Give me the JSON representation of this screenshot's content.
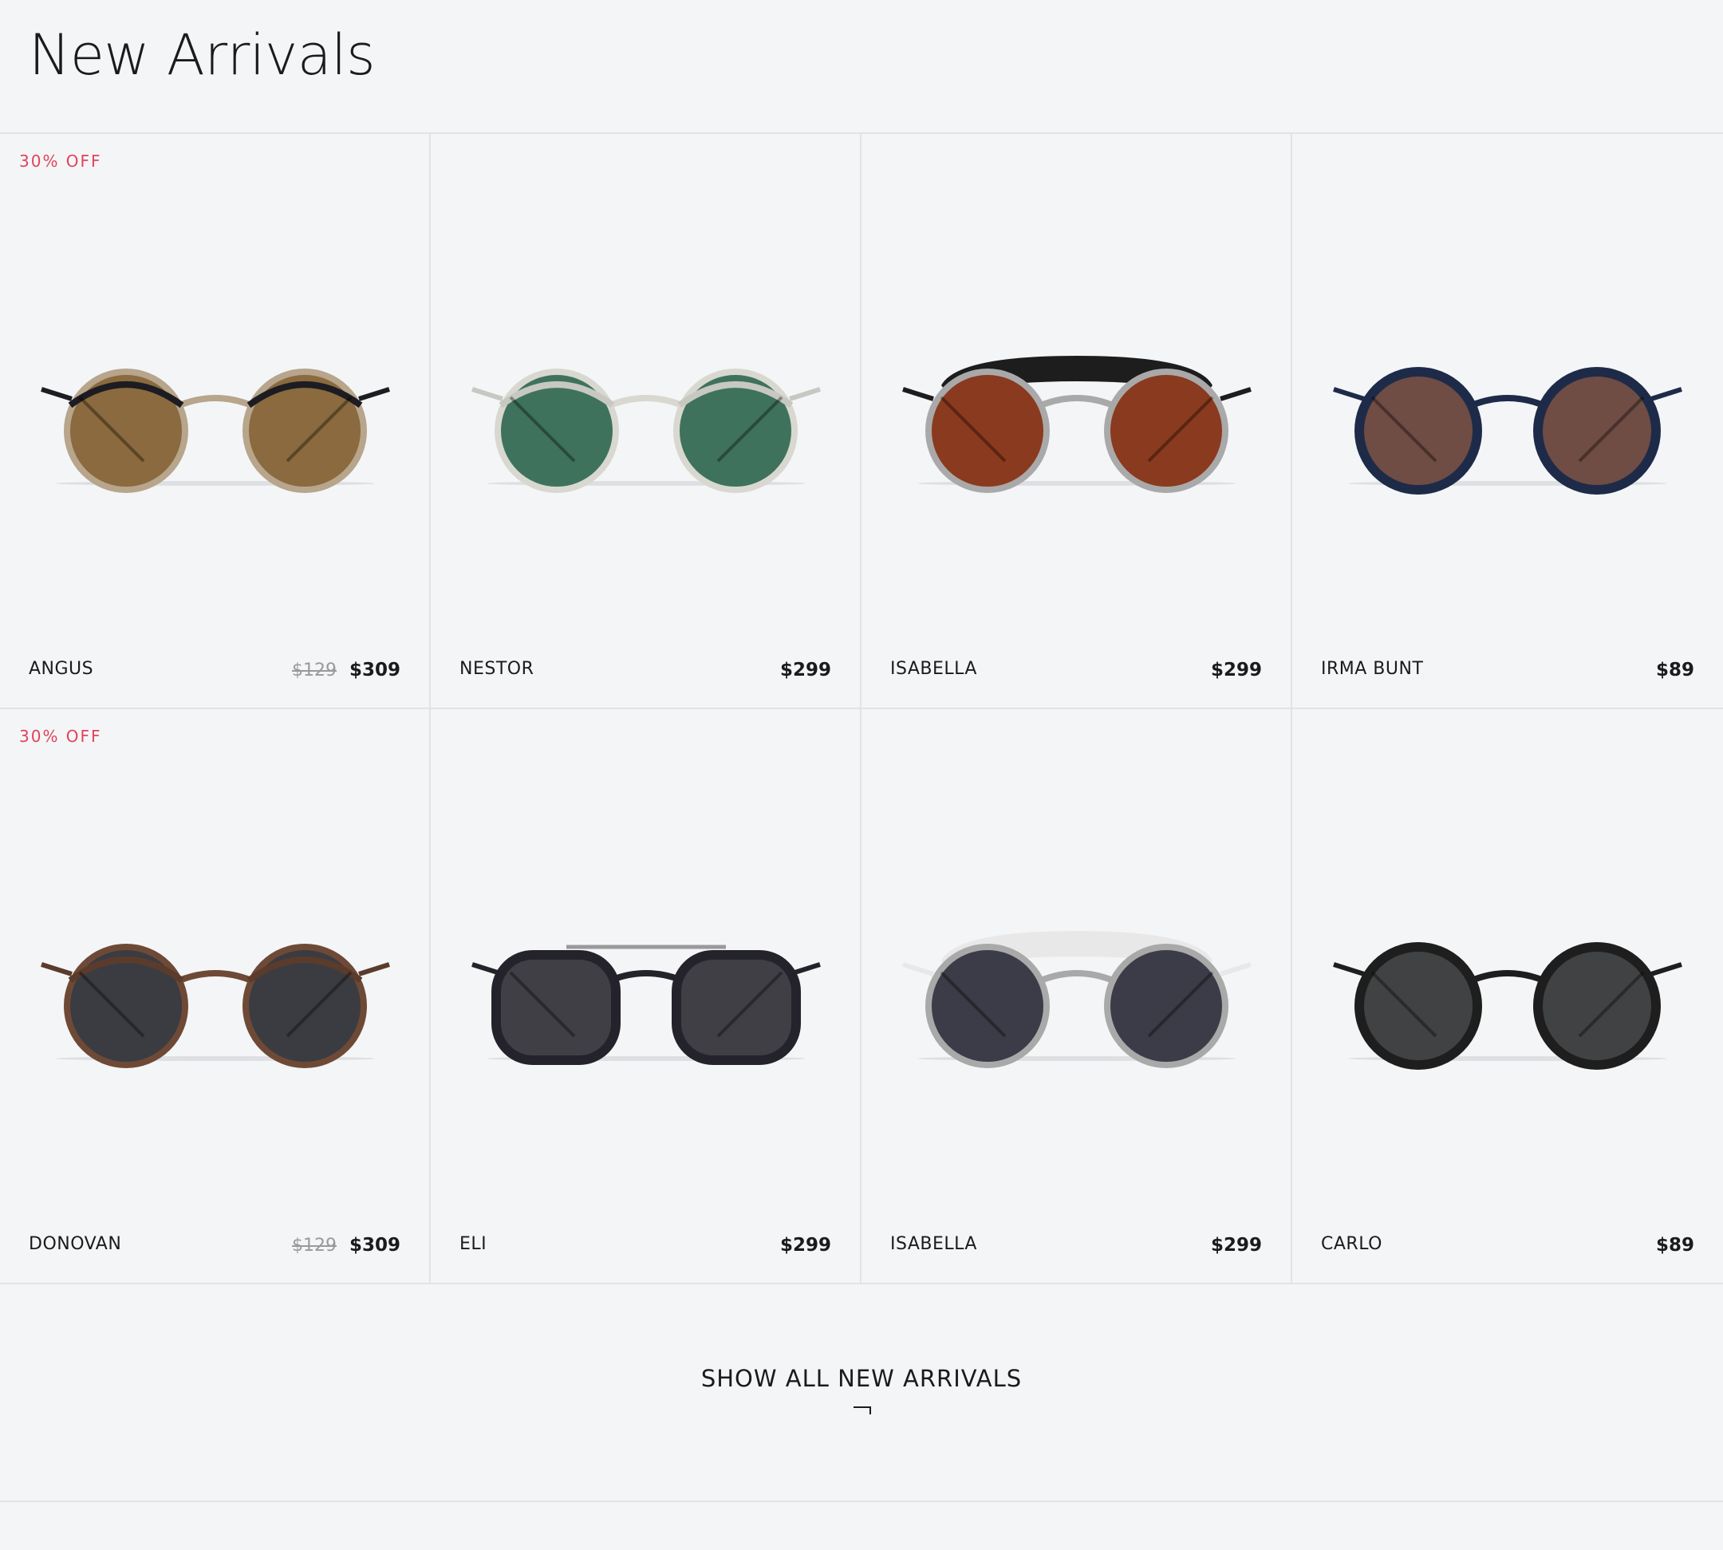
{
  "header": {
    "title": "New Arrivals"
  },
  "products": [
    {
      "name": "ANGUS",
      "badge": "30% OFF",
      "old_price": "$129",
      "price": "$309",
      "image": "round-brown-gradient-sunglasses",
      "frame": "#1c1c22",
      "lens": "#8a6a3e",
      "rim": "#b7a58c"
    },
    {
      "name": "NESTOR",
      "badge": "",
      "old_price": "",
      "price": "$299",
      "image": "round-silver-green-sunglasses",
      "frame": "#c8c8c2",
      "lens": "#3f725c",
      "rim": "#d8d8d0"
    },
    {
      "name": "ISABELLA",
      "badge": "",
      "old_price": "",
      "price": "$299",
      "image": "browbar-black-copper-sunglasses",
      "frame": "#1d1d1d",
      "lens": "#8a3a1e",
      "rim": "#a9a9a9"
    },
    {
      "name": "IRMA BUNT",
      "badge": "",
      "old_price": "",
      "price": "$89",
      "image": "round-navy-brown-sunglasses",
      "frame": "#1d2b49",
      "lens": "#6f4c44",
      "rim": "#1d2b49"
    },
    {
      "name": "DONOVAN",
      "badge": "30% OFF",
      "old_price": "$129",
      "price": "$309",
      "image": "round-brown-grey-sunglasses",
      "frame": "#5a3b2c",
      "lens": "#3b3c42",
      "rim": "#6e4a36"
    },
    {
      "name": "ELI",
      "badge": "",
      "old_price": "",
      "price": "$299",
      "image": "square-black-grey-sunglasses",
      "frame": "#24232b",
      "lens": "#3f3f45",
      "rim": "#24232b"
    },
    {
      "name": "ISABELLA",
      "badge": "",
      "old_price": "",
      "price": "$299",
      "image": "browbar-white-grey-sunglasses",
      "frame": "#e8e8e8",
      "lens": "#3c3c48",
      "rim": "#a9a9a9"
    },
    {
      "name": "CARLO",
      "badge": "",
      "old_price": "",
      "price": "$89",
      "image": "round-black-grey-sunglasses",
      "frame": "#1e1e1e",
      "lens": "#404243",
      "rim": "#1e1e1e"
    }
  ],
  "cta": {
    "label": "SHOW ALL NEW ARRIVALS"
  }
}
